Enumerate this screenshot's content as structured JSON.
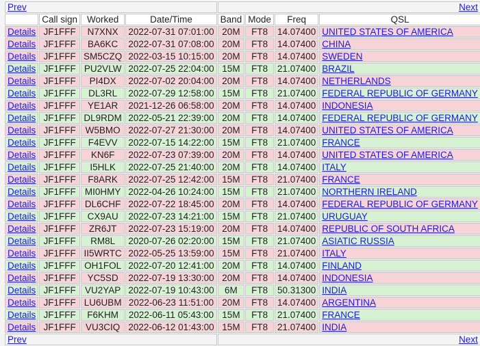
{
  "nav": {
    "prev_label": "Prev",
    "next_label": "Next"
  },
  "headers": [
    "",
    "Call sign",
    "Worked",
    "Date/Time",
    "Band",
    "Mode",
    "Freq",
    "QSL"
  ],
  "details_label": "Details",
  "colors": {
    "pink_row": "#f7d3d8",
    "green_row": "#d6f2d3",
    "link": "#1a1aee"
  },
  "rows": [
    {
      "call": "JF1FFF",
      "worked": "N7XNX",
      "dt": "2022-07-31 07:01:00",
      "band": "20M",
      "mode": "FT8",
      "freq": "14.07400",
      "qsl": "UNITED STATES OF AMERICA",
      "tone": "pink"
    },
    {
      "call": "JF1FFF",
      "worked": "BA6KC",
      "dt": "2022-07-31 07:08:00",
      "band": "20M",
      "mode": "FT8",
      "freq": "14.07400",
      "qsl": "CHINA",
      "tone": "pink"
    },
    {
      "call": "JF1FFF",
      "worked": "SM5CZQ",
      "dt": "2022-03-15 10:15:00",
      "band": "20M",
      "mode": "FT8",
      "freq": "14.07400",
      "qsl": "SWEDEN",
      "tone": "pink"
    },
    {
      "call": "JF1FFF",
      "worked": "PU2VLW",
      "dt": "2022-07-25 22:04:00",
      "band": "15M",
      "mode": "FT8",
      "freq": "21.07400",
      "qsl": "BRAZIL",
      "tone": "green"
    },
    {
      "call": "JF1FFF",
      "worked": "PI4DX",
      "dt": "2022-07-02 20:04:00",
      "band": "20M",
      "mode": "FT8",
      "freq": "14.07400",
      "qsl": "NETHERLANDS",
      "tone": "pink"
    },
    {
      "call": "JF1FFF",
      "worked": "DL3RL",
      "dt": "2022-07-29 12:58:00",
      "band": "15M",
      "mode": "FT8",
      "freq": "21.07400",
      "qsl": "FEDERAL REPUBLIC OF GERMANY",
      "tone": "green"
    },
    {
      "call": "JF1FFF",
      "worked": "YE1AR",
      "dt": "2021-12-26 06:58:00",
      "band": "20M",
      "mode": "FT8",
      "freq": "14.07400",
      "qsl": "INDONESIA",
      "tone": "pink"
    },
    {
      "call": "JF1FFF",
      "worked": "DL9RDM",
      "dt": "2022-05-21 22:39:00",
      "band": "20M",
      "mode": "FT8",
      "freq": "14.07400",
      "qsl": "FEDERAL REPUBLIC OF GERMANY",
      "tone": "green"
    },
    {
      "call": "JF1FFF",
      "worked": "W5BMO",
      "dt": "2022-07-27 21:30:00",
      "band": "20M",
      "mode": "FT8",
      "freq": "14.07400",
      "qsl": "UNITED STATES OF AMERICA",
      "tone": "pink"
    },
    {
      "call": "JF1FFF",
      "worked": "F4EVV",
      "dt": "2022-07-15 14:22:00",
      "band": "15M",
      "mode": "FT8",
      "freq": "21.07400",
      "qsl": "FRANCE",
      "tone": "green"
    },
    {
      "call": "JF1FFF",
      "worked": "KN6F",
      "dt": "2022-07-23 07:39:00",
      "band": "20M",
      "mode": "FT8",
      "freq": "14.07400",
      "qsl": "UNITED STATES OF AMERICA",
      "tone": "pink"
    },
    {
      "call": "JF1FFF",
      "worked": "I5HLK",
      "dt": "2022-07-25 21:40:00",
      "band": "20M",
      "mode": "FT8",
      "freq": "14.07400",
      "qsl": "ITALY",
      "tone": "green"
    },
    {
      "call": "JF1FFF",
      "worked": "F8ARK",
      "dt": "2022-07-25 12:42:00",
      "band": "15M",
      "mode": "FT8",
      "freq": "21.07400",
      "qsl": "FRANCE",
      "tone": "pink"
    },
    {
      "call": "JF1FFF",
      "worked": "MI0HMY",
      "dt": "2022-04-26 10:24:00",
      "band": "15M",
      "mode": "FT8",
      "freq": "21.07400",
      "qsl": "NORTHERN IRELAND",
      "tone": "green"
    },
    {
      "call": "JF1FFF",
      "worked": "DL6CHF",
      "dt": "2022-07-22 18:45:00",
      "band": "20M",
      "mode": "FT8",
      "freq": "14.07400",
      "qsl": "FEDERAL REPUBLIC OF GERMANY",
      "tone": "pink"
    },
    {
      "call": "JF1FFF",
      "worked": "CX9AU",
      "dt": "2022-07-23 14:21:00",
      "band": "15M",
      "mode": "FT8",
      "freq": "21.07400",
      "qsl": "URUGUAY",
      "tone": "green"
    },
    {
      "call": "JF1FFF",
      "worked": "ZR6JT",
      "dt": "2022-07-23 15:19:00",
      "band": "20M",
      "mode": "FT8",
      "freq": "14.07400",
      "qsl": "REPUBLIC OF SOUTH AFRICA",
      "tone": "pink"
    },
    {
      "call": "JF1FFF",
      "worked": "RM8L",
      "dt": "2020-07-26 02:20:00",
      "band": "15M",
      "mode": "FT8",
      "freq": "21.07400",
      "qsl": "ASIATIC RUSSIA",
      "tone": "green"
    },
    {
      "call": "JF1FFF",
      "worked": "II5WRTC",
      "dt": "2022-05-25 13:59:00",
      "band": "15M",
      "mode": "FT8",
      "freq": "21.07400",
      "qsl": "ITALY",
      "tone": "pink"
    },
    {
      "call": "JF1FFF",
      "worked": "OH1FOL",
      "dt": "2022-07-20 12:41:00",
      "band": "20M",
      "mode": "FT8",
      "freq": "14.07400",
      "qsl": "FINLAND",
      "tone": "green"
    },
    {
      "call": "JF1FFF",
      "worked": "YC5SD",
      "dt": "2022-07-19 13:30:00",
      "band": "20M",
      "mode": "FT8",
      "freq": "14.07400",
      "qsl": "INDONESIA",
      "tone": "pink"
    },
    {
      "call": "JF1FFF",
      "worked": "VU2YAP",
      "dt": "2022-07-19 10:43:00",
      "band": "6M",
      "mode": "FT8",
      "freq": "50.31300",
      "qsl": "INDIA",
      "tone": "green"
    },
    {
      "call": "JF1FFF",
      "worked": "LU6UBM",
      "dt": "2022-06-23 11:51:00",
      "band": "20M",
      "mode": "FT8",
      "freq": "14.07400",
      "qsl": "ARGENTINA",
      "tone": "pink"
    },
    {
      "call": "JF1FFF",
      "worked": "F6KHM",
      "dt": "2022-06-11 05:43:00",
      "band": "15M",
      "mode": "FT8",
      "freq": "21.07400",
      "qsl": "FRANCE",
      "tone": "green"
    },
    {
      "call": "JF1FFF",
      "worked": "VU3CIQ",
      "dt": "2022-06-12 01:43:00",
      "band": "15M",
      "mode": "FT8",
      "freq": "21.07400",
      "qsl": "INDIA",
      "tone": "pink"
    }
  ]
}
